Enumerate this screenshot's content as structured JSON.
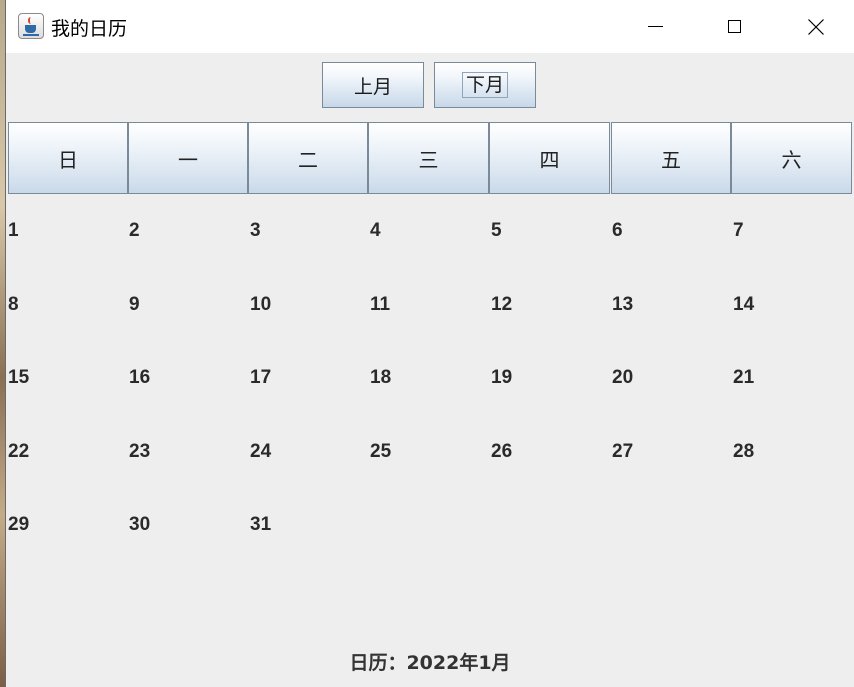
{
  "window": {
    "title": "我的日历",
    "icon": "java-cup-icon"
  },
  "window_controls": {
    "minimize_icon": "minimize-icon",
    "maximize_icon": "maximize-icon",
    "close_icon": "close-icon"
  },
  "toolbar": {
    "prev_label": "上月",
    "next_label": "下月"
  },
  "weekdays": [
    "日",
    "一",
    "二",
    "三",
    "四",
    "五",
    "六"
  ],
  "days": [
    [
      "1",
      "2",
      "3",
      "4",
      "5",
      "6",
      "7"
    ],
    [
      "8",
      "9",
      "10",
      "11",
      "12",
      "13",
      "14"
    ],
    [
      "15",
      "16",
      "17",
      "18",
      "19",
      "20",
      "21"
    ],
    [
      "22",
      "23",
      "24",
      "25",
      "26",
      "27",
      "28"
    ],
    [
      "29",
      "30",
      "31",
      "",
      "",
      "",
      ""
    ]
  ],
  "status": {
    "text": "日历：2022年1月"
  },
  "colors": {
    "window_bg": "#eeeeee",
    "titlebar_bg": "#ffffff",
    "button_border": "#7a8a99",
    "button_gradient_bottom": "#c8d8e8",
    "text": "#2a2a2a"
  }
}
